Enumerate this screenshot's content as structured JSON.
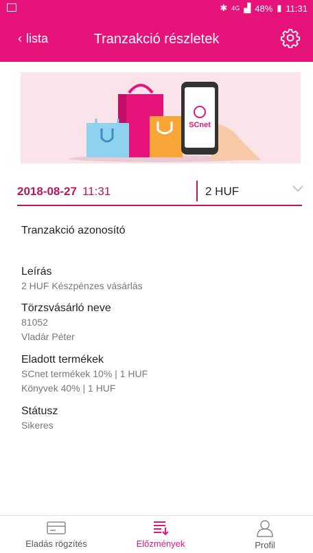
{
  "status_bar": {
    "battery": "48%",
    "time": "11:31",
    "network": "4G"
  },
  "appbar": {
    "back_label": "lista",
    "title": "Tranzakció részletek"
  },
  "banner": {
    "brand_text": "SCnet"
  },
  "summary": {
    "date": "2018-08-27",
    "time": "11:31",
    "amount": "2 HUF"
  },
  "details": {
    "transaction_id_label": "Tranzakció azonosító",
    "description_label": "Leírás",
    "description_value": "2 HUF Készpénzes vásárlás",
    "customer_label": "Törzsvásárló neve",
    "customer_id": "81052",
    "customer_name": "Vladár Péter",
    "products_label": "Eladott termékek",
    "products": [
      "SCnet termékek 10% | 1 HUF",
      "Könyvek 40% | 1 HUF"
    ],
    "status_label": "Státusz",
    "status_value": "Sikeres"
  },
  "bottom_nav": [
    {
      "label": "Eladás rögzítés",
      "icon": "card-icon",
      "active": false
    },
    {
      "label": "Előzmények",
      "icon": "history-icon",
      "active": true
    },
    {
      "label": "Profil",
      "icon": "person-icon",
      "active": false
    }
  ],
  "colors": {
    "brand": "#e5137a",
    "accent": "#b5175f"
  }
}
